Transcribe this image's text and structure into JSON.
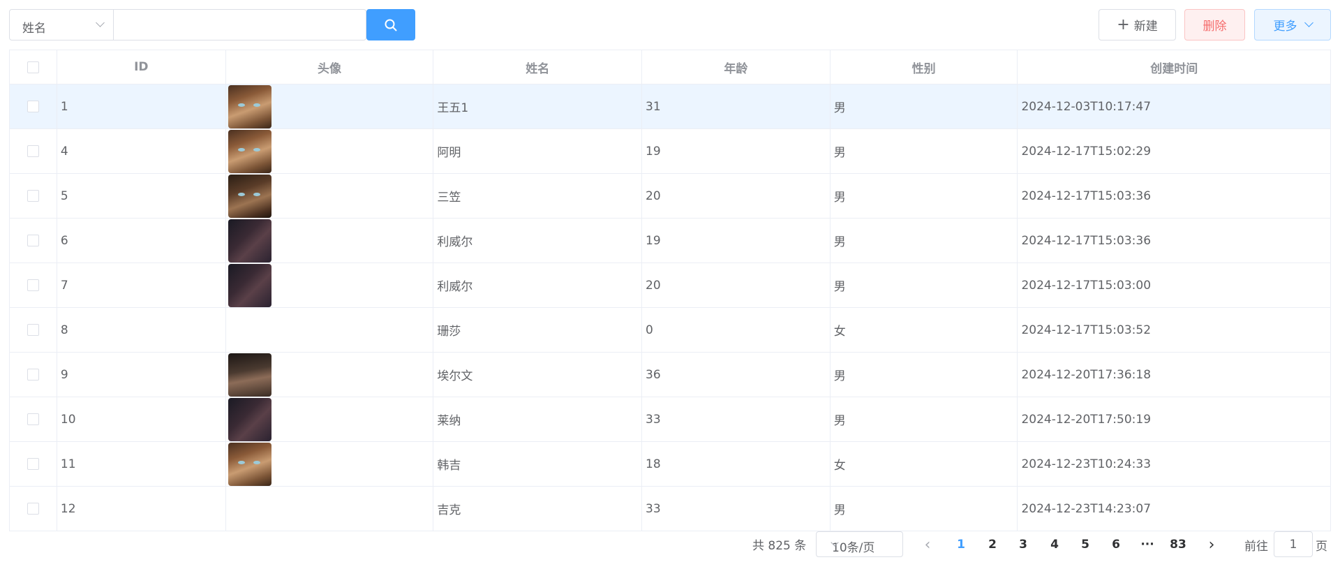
{
  "toolbar": {
    "search_field_select": "姓名",
    "search_value": "",
    "new_label": "新建",
    "delete_label": "删除",
    "more_label": "更多"
  },
  "table": {
    "headers": [
      "ID",
      "头像",
      "姓名",
      "年龄",
      "性别",
      "创建时间"
    ],
    "rows": [
      {
        "id": "1",
        "avatar": "face-a",
        "name": "王五1",
        "age": "31",
        "gender": "男",
        "created": "2024-12-03T10:17:47"
      },
      {
        "id": "4",
        "avatar": "face-a",
        "name": "阿明",
        "age": "19",
        "gender": "男",
        "created": "2024-12-17T15:02:29"
      },
      {
        "id": "5",
        "avatar": "face-b",
        "name": "三笠",
        "age": "20",
        "gender": "男",
        "created": "2024-12-17T15:03:36"
      },
      {
        "id": "6",
        "avatar": "dark",
        "name": "利威尔",
        "age": "19",
        "gender": "男",
        "created": "2024-12-17T15:03:36"
      },
      {
        "id": "7",
        "avatar": "dark",
        "name": "利威尔",
        "age": "20",
        "gender": "男",
        "created": "2024-12-17T15:03:00"
      },
      {
        "id": "8",
        "avatar": "",
        "name": "珊莎",
        "age": "0",
        "gender": "女",
        "created": "2024-12-17T15:03:52"
      },
      {
        "id": "9",
        "avatar": "old",
        "name": "埃尔文",
        "age": "36",
        "gender": "男",
        "created": "2024-12-20T17:36:18"
      },
      {
        "id": "10",
        "avatar": "dark",
        "name": "莱纳",
        "age": "33",
        "gender": "男",
        "created": "2024-12-20T17:50:19"
      },
      {
        "id": "11",
        "avatar": "face-a",
        "name": "韩吉",
        "age": "18",
        "gender": "女",
        "created": "2024-12-23T10:24:33"
      },
      {
        "id": "12",
        "avatar": "",
        "name": "吉克",
        "age": "33",
        "gender": "男",
        "created": "2024-12-23T14:23:07"
      }
    ],
    "highlighted_row_id": "1"
  },
  "pagination": {
    "total_text": "共 825 条",
    "page_size": "10条/页",
    "pages": [
      "1",
      "2",
      "3",
      "4",
      "5",
      "6",
      "···",
      "83"
    ],
    "current_page": "1",
    "goto_label": "前往",
    "goto_value": "1",
    "page_suffix": "页"
  },
  "colors": {
    "primary": "#409eff",
    "danger": "#f56c6c",
    "row_highlight": "#ecf5ff",
    "border": "#ebeef5"
  }
}
